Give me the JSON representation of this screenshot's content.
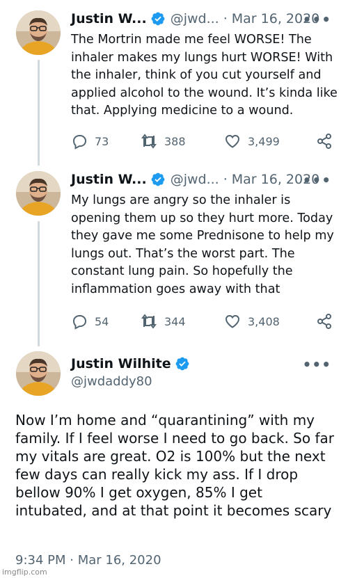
{
  "tweets": [
    {
      "name": "Justin W...",
      "handle": "@jwd...",
      "separator": "·",
      "date": "Mar 16, 2020",
      "more": "•••",
      "text": "The Mortrin made me feel WORSE! The inhaler makes my lungs hurt WORSE! With the inhaler, think of you cut yourself and applied alcohol to the wound. It’s kinda like that. Applying medicine to a wound.",
      "replies": "73",
      "retweets": "388",
      "likes": "3,499"
    },
    {
      "name": "Justin W...",
      "handle": "@jwd...",
      "separator": "·",
      "date": "Mar 16, 2020",
      "more": "•••",
      "text": "My lungs are angry so the inhaler is opening them up so they hurt more. Today they gave me some Prednisone to help my lungs out. That’s the worst part. The constant lung pain. So hopefully the inflammation goes away with that",
      "replies": "54",
      "retweets": "344",
      "likes": "3,408"
    }
  ],
  "main_tweet": {
    "name": "Justin Wilhite",
    "handle": "@jwdaddy80",
    "more": "•••",
    "text": "Now I’m home and “quarantining” with my family. If I feel worse I need to go back. So far my vitals are great. O2 is 100% but the next few days can really kick my ass. If I drop bellow 90% I get oxygen, 85% I get intubated, and at that point it becomes scary",
    "timestamp": "9:34 PM · Mar 16, 2020"
  },
  "watermark": "imgflip.com",
  "colors": {
    "verified": "#1d9bf0",
    "secondary_text": "#536471",
    "thread_line": "#cfd9de"
  },
  "icons": [
    "reply-icon",
    "retweet-icon",
    "like-icon",
    "share-icon",
    "verified-badge-icon",
    "more-icon"
  ]
}
